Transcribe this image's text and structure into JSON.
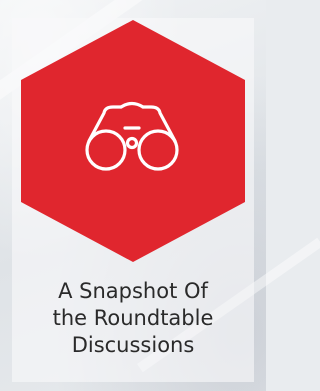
{
  "tile": {
    "icon": "binoculars-icon",
    "accent_color": "#e0262e",
    "title_lines": [
      "A Snapshot Of",
      "the Roundtable",
      "Discussions"
    ]
  }
}
